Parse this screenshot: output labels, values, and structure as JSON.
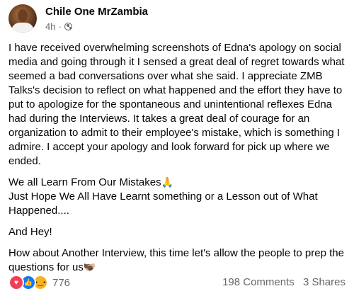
{
  "post": {
    "author": "Chile One MrZambia",
    "time": "4h",
    "dot": "·",
    "privacy_icon": "globe-icon",
    "paragraphs": [
      "I have received overwhelming screenshots of Edna's apology on social media  and going through it I sensed a great deal of regret towards what seemed a bad conversations over what she said. I appreciate ZMB Talks's decision to reflect on what happened and the effort they have to put to apologize for the spontaneous and unintentional reflexes Edna had during the Interviews. It takes a great deal of courage for an organization to admit to their employee's mistake, which is something I admire. I accept your apology and look forward for pick up where we ended.",
      "And Hey!"
    ],
    "learn_line_1": "We all Learn From Our Mistakes",
    "learn_emoji": "🙏",
    "learn_line_2": "Just Hope We All Have Learnt something or a Lesson out of What Happened....",
    "closing_text": "How about Another Interview, this time let's allow the people to prep the questions for us",
    "closing_emoji": "🫱🏿‍🫲🏼"
  },
  "footer": {
    "reactions": [
      "love",
      "like",
      "wow"
    ],
    "reaction_count": "776",
    "comments": "198 Comments",
    "shares": "3 Shares"
  }
}
